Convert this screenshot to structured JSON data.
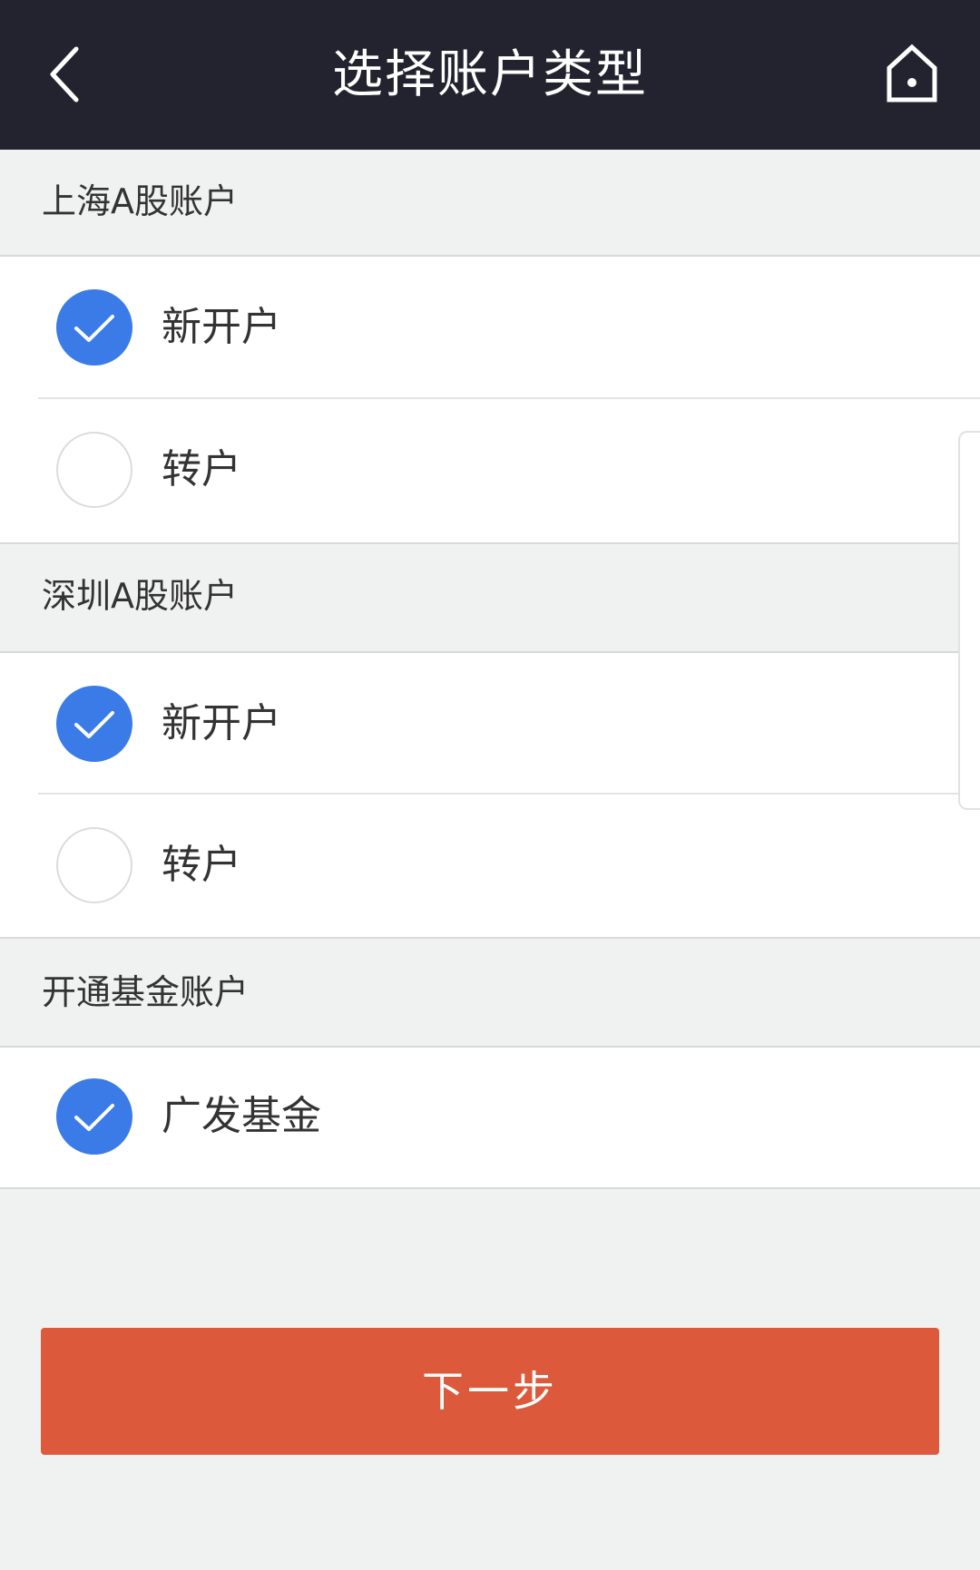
{
  "header": {
    "title": "选择账户类型",
    "back_icon": "chevron-left-icon",
    "home_icon": "home-icon"
  },
  "sections": [
    {
      "title": "上海A股账户",
      "options": [
        {
          "label": "新开户",
          "checked": true
        },
        {
          "label": "转户",
          "checked": false
        }
      ]
    },
    {
      "title": "深圳A股账户",
      "options": [
        {
          "label": "新开户",
          "checked": true
        },
        {
          "label": "转户",
          "checked": false
        }
      ]
    },
    {
      "title": "开通基金账户",
      "options": [
        {
          "label": "广发基金",
          "checked": true
        }
      ]
    }
  ],
  "next_button": {
    "label": "下一步"
  },
  "colors": {
    "navbar": "#22232e",
    "accent_blue": "#3a7be8",
    "primary_button": "#dc5a3b",
    "background": "#f0f1f1"
  }
}
